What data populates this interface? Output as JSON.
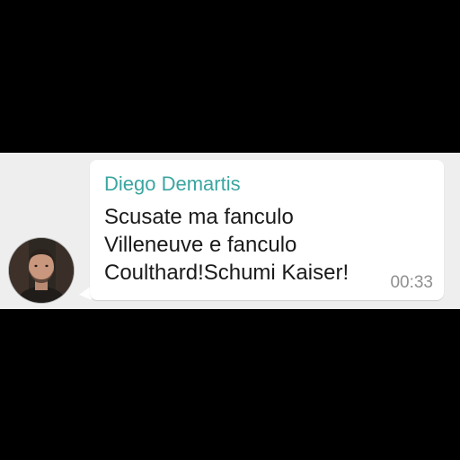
{
  "message": {
    "sender_name": "Diego Demartis",
    "lines": [
      "Scusate ma fanculo",
      "Villeneuve e fanculo",
      "Coulthard!Schumi Kaiser!"
    ],
    "time": "00:33"
  },
  "colors": {
    "sender_name": "#3aa6a0",
    "bubble": "#ffffff",
    "chat_background": "#eeeeee",
    "outside": "#000000"
  }
}
